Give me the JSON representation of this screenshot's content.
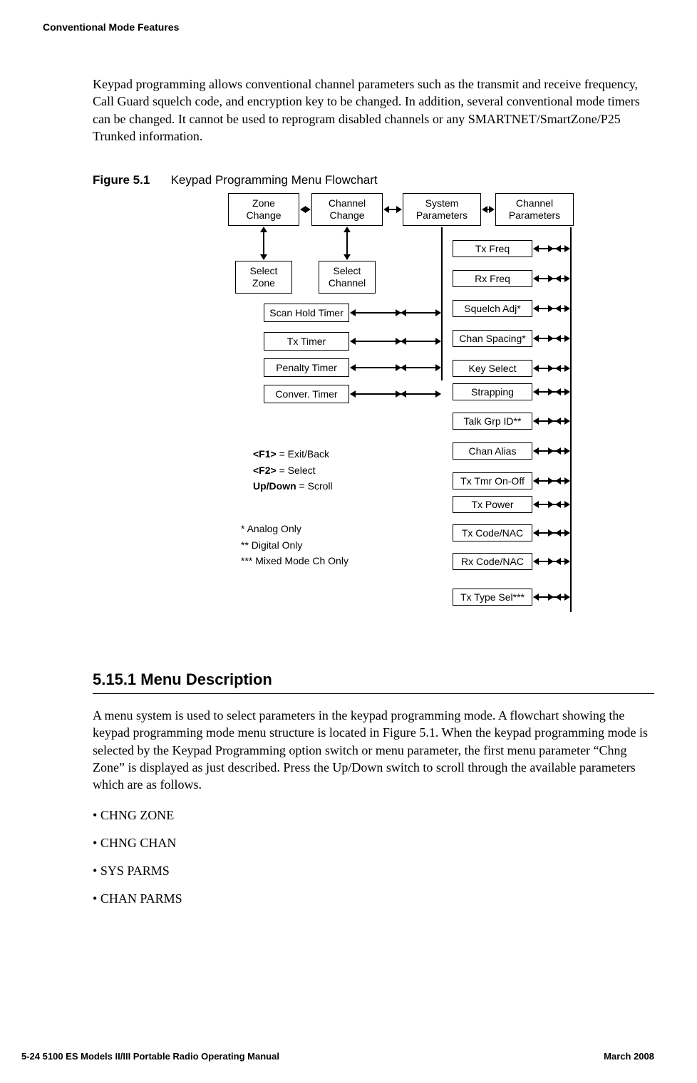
{
  "header": {
    "section_title": "Conventional Mode Features"
  },
  "intro_paragraph": "Keypad programming allows conventional channel parameters such as the transmit and receive frequency, Call Guard squelch code, and encryption key to be changed. In addition, several conventional mode timers can be changed. It cannot be used to reprogram disabled channels or any SMARTNET/SmartZone/P25 Trunked information.",
  "figure": {
    "label": "Figure 5.1",
    "title": "Keypad Programming Menu Flowchart",
    "top_boxes": {
      "zone_change": "Zone\nChange",
      "channel_change": "Channel\nChange",
      "system_parameters": "System\nParameters",
      "channel_parameters": "Channel\nParameters"
    },
    "sub_boxes": {
      "select_zone": "Select\nZone",
      "select_channel": "Select\nChannel"
    },
    "system_timers": [
      "Scan Hold Timer",
      "Tx Timer",
      "Penalty Timer",
      "Conver. Timer"
    ],
    "channel_params": [
      "Tx Freq",
      "Rx Freq",
      "Squelch Adj*",
      "Chan Spacing*",
      "Key Select",
      "Strapping",
      "Talk Grp ID**",
      "Chan Alias",
      "Tx Tmr On-Off",
      "Tx Power",
      "Tx Code/NAC",
      "Rx Code/NAC",
      "Tx Type Sel***"
    ],
    "legend": {
      "f1_key": "<F1>",
      "f1_desc": " = Exit/Back",
      "f2_key": "<F2>",
      "f2_desc": " = Select",
      "updown_key": "Up/Down",
      "updown_desc": " = Scroll"
    },
    "notes": {
      "n1": "  * Analog Only",
      "n2": " ** Digital Only",
      "n3": "*** Mixed Mode Ch Only"
    }
  },
  "section": {
    "heading": "5.15.1   Menu Description",
    "paragraph": "A menu system is used to select parameters in the keypad programming mode. A flowchart showing the keypad programming mode menu structure is located in Figure 5.1. When the keypad programming mode is selected by the Keypad Programming option switch or menu parameter, the first menu parameter “Chng Zone” is displayed as just described. Press the Up/Down switch to scroll through the available parameters which are as follows.",
    "bullets": [
      "CHNG ZONE",
      "CHNG CHAN",
      "SYS PARMS",
      "CHAN PARMS"
    ]
  },
  "footer": {
    "left": "5-24     5100 ES Models II/III Portable Radio Operating Manual",
    "right": "March 2008"
  },
  "chart_data": {
    "type": "diagram",
    "title": "Keypad Programming Menu Flowchart",
    "nodes": {
      "top_level": [
        "Zone Change",
        "Channel Change",
        "System Parameters",
        "Channel Parameters"
      ],
      "zone_change_children": [
        "Select Zone"
      ],
      "channel_change_children": [
        "Select Channel"
      ],
      "system_parameters_children": [
        "Scan Hold Timer",
        "Tx Timer",
        "Penalty Timer",
        "Conver. Timer"
      ],
      "channel_parameters_children": [
        "Tx Freq",
        "Rx Freq",
        "Squelch Adj*",
        "Chan Spacing*",
        "Key Select",
        "Strapping",
        "Talk Grp ID**",
        "Chan Alias",
        "Tx Tmr On-Off",
        "Tx Power",
        "Tx Code/NAC",
        "Rx Code/NAC",
        "Tx Type Sel***"
      ]
    },
    "annotations": {
      "*": "Analog Only",
      "**": "Digital Only",
      "***": "Mixed Mode Ch Only"
    },
    "key_legend": {
      "<F1>": "Exit/Back",
      "<F2>": "Select",
      "Up/Down": "Scroll"
    }
  }
}
